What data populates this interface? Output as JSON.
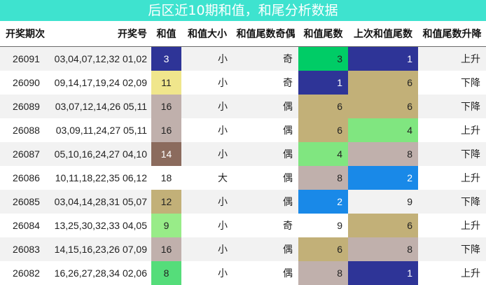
{
  "title": "后区近10期和值，和尾分析数据",
  "headers": [
    "开奖期次",
    "开奖号",
    "和值",
    "和值大小",
    "和值尾数奇偶",
    "和值尾数",
    "上次和值尾数",
    "和值尾数升降"
  ],
  "rows": [
    {
      "period": "26091",
      "numbers": "03,04,07,12,32 01,02",
      "sum": "3",
      "size": "小",
      "parity": "奇",
      "tail": "3",
      "prev_tail": "1",
      "trend": "上升",
      "sum_bg": "#2e3497",
      "sum_fg": "#ffffff",
      "tail_bg": "#00cc66",
      "tail_fg": "#222222",
      "prev_bg": "#2e3497",
      "prev_fg": "#ffffff"
    },
    {
      "period": "26090",
      "numbers": "09,14,17,19,24 02,09",
      "sum": "11",
      "size": "小",
      "parity": "奇",
      "tail": "1",
      "prev_tail": "6",
      "trend": "下降",
      "sum_bg": "#f0e68c",
      "sum_fg": "#222222",
      "tail_bg": "#2e3497",
      "tail_fg": "#ffffff",
      "prev_bg": "#c2b078",
      "prev_fg": "#222222"
    },
    {
      "period": "26089",
      "numbers": "03,07,12,14,26 05,11",
      "sum": "16",
      "size": "小",
      "parity": "偶",
      "tail": "6",
      "prev_tail": "6",
      "trend": "下降",
      "sum_bg": "#c0b0ac",
      "sum_fg": "#222222",
      "tail_bg": "#c2b078",
      "tail_fg": "#222222",
      "prev_bg": "#c2b078",
      "prev_fg": "#222222"
    },
    {
      "period": "26088",
      "numbers": "03,09,11,24,27 05,11",
      "sum": "16",
      "size": "小",
      "parity": "偶",
      "tail": "6",
      "prev_tail": "4",
      "trend": "上升",
      "sum_bg": "#c0b0ac",
      "sum_fg": "#222222",
      "tail_bg": "#c2b078",
      "tail_fg": "#222222",
      "prev_bg": "#80e680",
      "prev_fg": "#222222"
    },
    {
      "period": "26087",
      "numbers": "05,10,16,24,27 04,10",
      "sum": "14",
      "size": "小",
      "parity": "偶",
      "tail": "4",
      "prev_tail": "8",
      "trend": "下降",
      "sum_bg": "#8b6b5d",
      "sum_fg": "#ffffff",
      "tail_bg": "#80e680",
      "tail_fg": "#222222",
      "prev_bg": "#c0b0ac",
      "prev_fg": "#222222"
    },
    {
      "period": "26086",
      "numbers": "10,11,18,22,35 06,12",
      "sum": "18",
      "size": "大",
      "parity": "偶",
      "tail": "8",
      "prev_tail": "2",
      "trend": "上升",
      "sum_bg": "",
      "sum_fg": "#222222",
      "tail_bg": "#c0b0ac",
      "tail_fg": "#222222",
      "prev_bg": "#1989e8",
      "prev_fg": "#ffffff"
    },
    {
      "period": "26085",
      "numbers": "03,04,14,28,31 05,07",
      "sum": "12",
      "size": "小",
      "parity": "偶",
      "tail": "2",
      "prev_tail": "9",
      "trend": "下降",
      "sum_bg": "#c2b078",
      "sum_fg": "#222222",
      "tail_bg": "#1989e8",
      "tail_fg": "#ffffff",
      "prev_bg": "",
      "prev_fg": "#222222"
    },
    {
      "period": "26084",
      "numbers": "13,25,30,32,33 04,05",
      "sum": "9",
      "size": "小",
      "parity": "奇",
      "tail": "9",
      "prev_tail": "6",
      "trend": "上升",
      "sum_bg": "#98ec88",
      "sum_fg": "#222222",
      "tail_bg": "",
      "tail_fg": "#222222",
      "prev_bg": "#c2b078",
      "prev_fg": "#222222"
    },
    {
      "period": "26083",
      "numbers": "14,15,16,23,26 07,09",
      "sum": "16",
      "size": "小",
      "parity": "偶",
      "tail": "6",
      "prev_tail": "8",
      "trend": "下降",
      "sum_bg": "#c0b0ac",
      "sum_fg": "#222222",
      "tail_bg": "#c2b078",
      "tail_fg": "#222222",
      "prev_bg": "#c0b0ac",
      "prev_fg": "#222222"
    },
    {
      "period": "26082",
      "numbers": "16,26,27,28,34 02,06",
      "sum": "8",
      "size": "小",
      "parity": "偶",
      "tail": "8",
      "prev_tail": "1",
      "trend": "上升",
      "sum_bg": "#55dd7a",
      "sum_fg": "#222222",
      "tail_bg": "#c0b0ac",
      "tail_fg": "#222222",
      "prev_bg": "#2e3497",
      "prev_fg": "#ffffff"
    }
  ]
}
